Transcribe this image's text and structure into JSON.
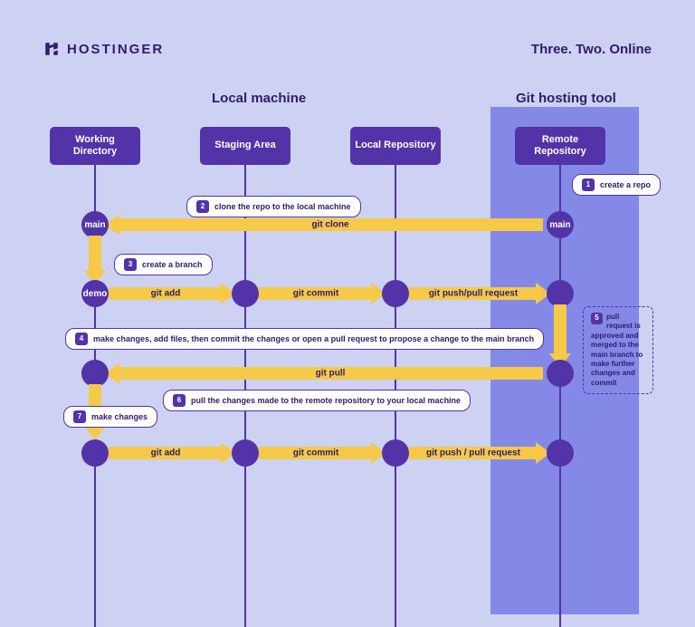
{
  "brand": {
    "name": "HOSTINGER",
    "tagline": "Three. Two. Online"
  },
  "sections": {
    "local": "Local machine",
    "remote": "Git hosting tool"
  },
  "lanes": {
    "working": "Working Directory",
    "staging": "Staging Area",
    "localrepo": "Local Repository",
    "remoterepo": "Remote Repository"
  },
  "nodes": {
    "main": "main",
    "demo": "demo"
  },
  "arrows": {
    "clone": "git clone",
    "add1": "git add",
    "commit1": "git commit",
    "push1": "git push/pull request",
    "pull": "git pull",
    "add2": "git add",
    "commit2": "git commit",
    "push2": "git push / pull request"
  },
  "steps": {
    "s1": {
      "n": "1",
      "t": "create a repo"
    },
    "s2": {
      "n": "2",
      "t": "clone the repo to the local machine"
    },
    "s3": {
      "n": "3",
      "t": "create a branch"
    },
    "s4": {
      "n": "4",
      "t": "make changes, add files, then commit the changes or open a pull request to propose a change to the main branch"
    },
    "s5": {
      "n": "5",
      "t": "pull request is approved and merged to the main branch to make further changes and commit"
    },
    "s6": {
      "n": "6",
      "t": "pull the changes made to the remote repository to your local machine"
    },
    "s7": {
      "n": "7",
      "t": "make changes"
    }
  }
}
